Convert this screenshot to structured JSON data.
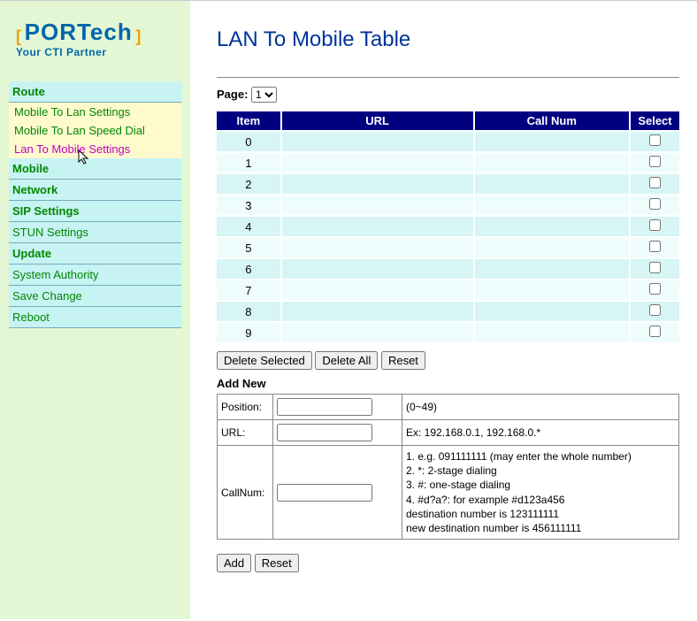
{
  "brand": {
    "name": "PORTech",
    "tagline": "Your CTI Partner"
  },
  "menu": {
    "route": "Route",
    "sub1": "Mobile To Lan Settings",
    "sub2": "Mobile To Lan Speed Dial",
    "sub3": "Lan To Mobile Settings",
    "mobile": "Mobile",
    "network": "Network",
    "sip": "SIP Settings",
    "stun": "STUN Settings",
    "update": "Update",
    "sysauth": "System Authority",
    "save": "Save Change",
    "reboot": "Reboot"
  },
  "title": "LAN To Mobile Table",
  "pager": {
    "label": "Page:",
    "selected": "1",
    "options": [
      "1"
    ]
  },
  "table": {
    "headers": {
      "item": "Item",
      "url": "URL",
      "callnum": "Call Num",
      "select": "Select"
    },
    "rows": [
      {
        "item": "0",
        "url": "",
        "callnum": "",
        "select": false
      },
      {
        "item": "1",
        "url": "",
        "callnum": "",
        "select": false
      },
      {
        "item": "2",
        "url": "",
        "callnum": "",
        "select": false
      },
      {
        "item": "3",
        "url": "",
        "callnum": "",
        "select": false
      },
      {
        "item": "4",
        "url": "",
        "callnum": "",
        "select": false
      },
      {
        "item": "5",
        "url": "",
        "callnum": "",
        "select": false
      },
      {
        "item": "6",
        "url": "",
        "callnum": "",
        "select": false
      },
      {
        "item": "7",
        "url": "",
        "callnum": "",
        "select": false
      },
      {
        "item": "8",
        "url": "",
        "callnum": "",
        "select": false
      },
      {
        "item": "9",
        "url": "",
        "callnum": "",
        "select": false
      }
    ]
  },
  "buttons": {
    "delete_selected": "Delete Selected",
    "delete_all": "Delete All",
    "reset1": "Reset",
    "add": "Add",
    "reset2": "Reset"
  },
  "addnew": {
    "title": "Add New",
    "position_label": "Position:",
    "position_value": "",
    "position_help": "(0~49)",
    "url_label": "URL:",
    "url_value": "",
    "url_help": "Ex: 192.168.0.1, 192.168.0.*",
    "callnum_label": "CallNum:",
    "callnum_value": "",
    "callnum_help": {
      "l1": "1. e.g. 091111111 (may enter the whole number)",
      "l2": "2. *: 2-stage dialing",
      "l3": "3. #: one-stage dialing",
      "l4": "4. #d?a?: for example #d123a456",
      "l5": "destination number is 123111111",
      "l6": "new destination number is 456111111"
    }
  }
}
